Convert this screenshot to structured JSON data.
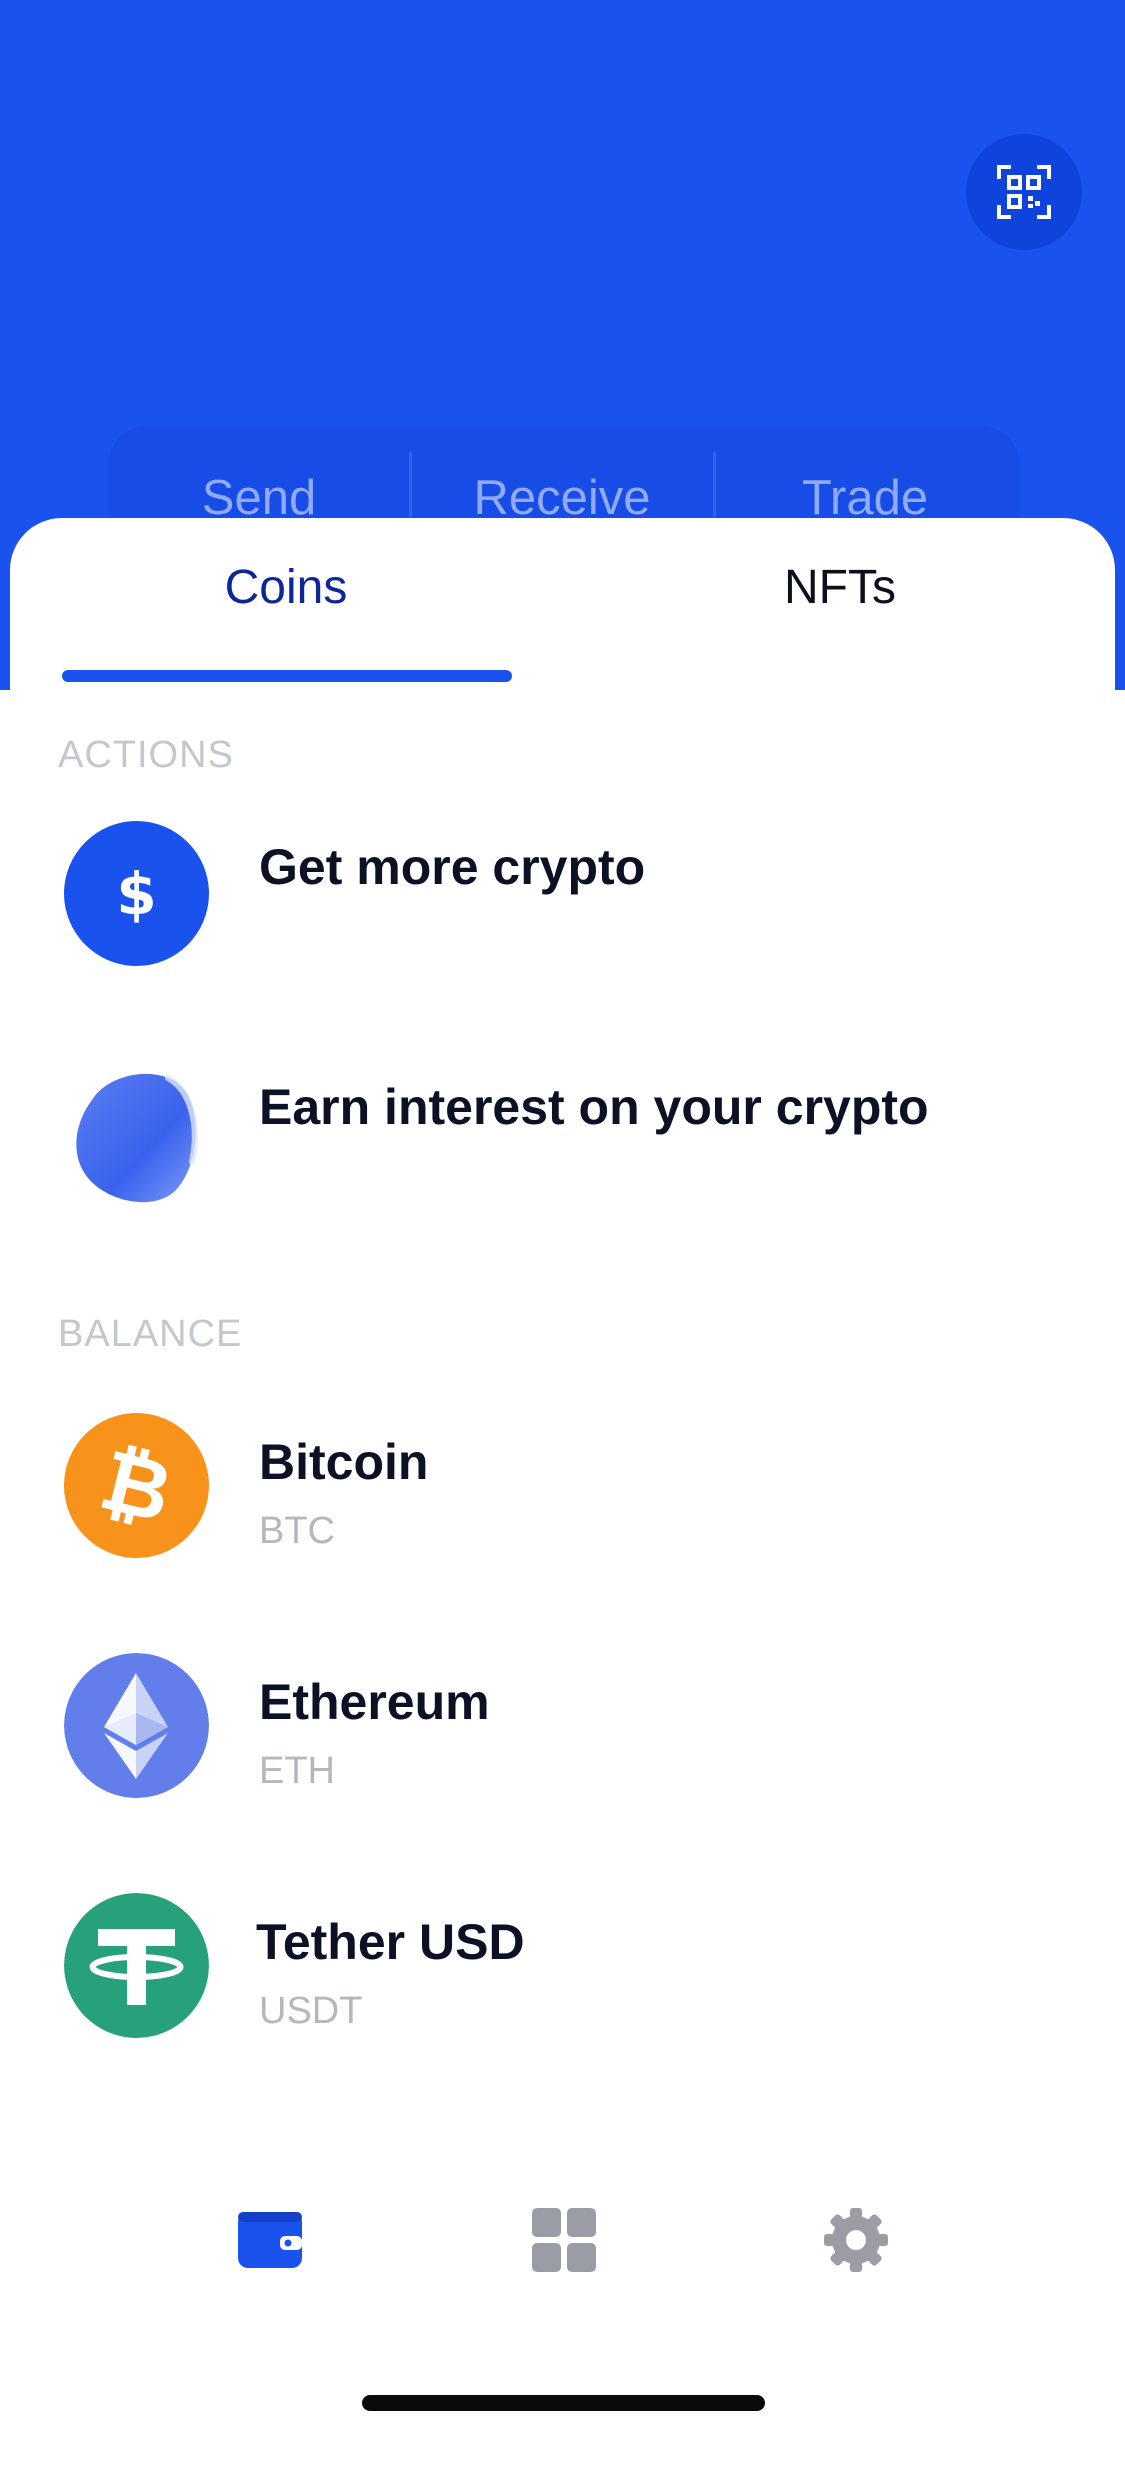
{
  "header": {
    "qr_icon": "qr-code-icon",
    "background_color": "#1a52ee"
  },
  "quick_actions": {
    "send": "Send",
    "receive": "Receive",
    "trade": "Trade"
  },
  "tabs": {
    "coins": "Coins",
    "nfts": "NFTs",
    "active": "Coins"
  },
  "actions_section": {
    "title": "ACTIONS",
    "items": [
      {
        "label": "Get more crypto",
        "icon": "dollar-icon"
      },
      {
        "label": "Earn interest on your crypto",
        "icon": "blob-icon"
      }
    ]
  },
  "balance_section": {
    "title": "BALANCE",
    "coins": [
      {
        "name": "Bitcoin",
        "symbol": "BTC",
        "icon": "bitcoin-icon",
        "color": "#f7931a"
      },
      {
        "name": "Ethereum",
        "symbol": "ETH",
        "icon": "ethereum-icon",
        "color": "#627eea"
      },
      {
        "name": "Tether USD",
        "symbol": "USDT",
        "icon": "tether-icon",
        "color": "#26a17b"
      }
    ]
  },
  "bottom_nav": {
    "items": [
      "wallet-icon",
      "apps-grid-icon",
      "settings-gear-icon"
    ],
    "active": "wallet-icon",
    "active_color": "#1a52ee",
    "inactive_color": "#9a9da3"
  }
}
